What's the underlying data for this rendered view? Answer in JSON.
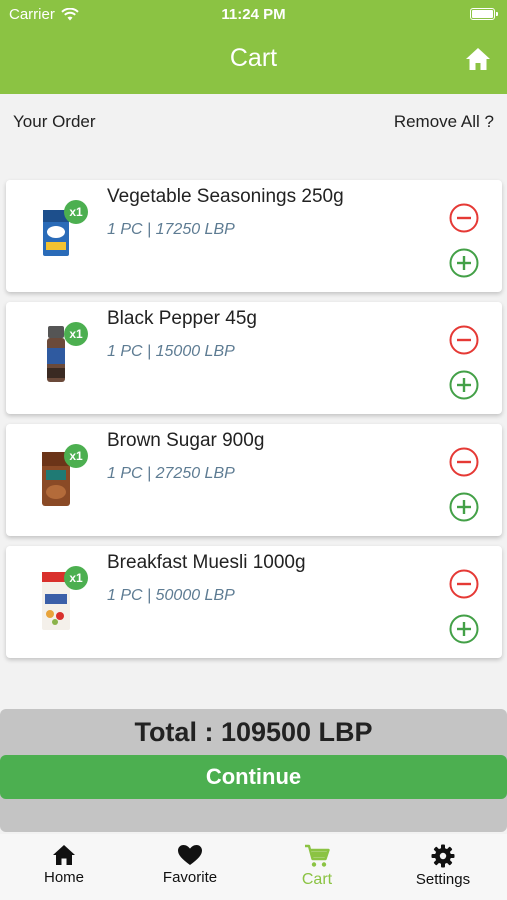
{
  "status_bar": {
    "carrier": "Carrier",
    "time": "11:24 PM"
  },
  "header": {
    "title": "Cart",
    "home_icon": "home-icon"
  },
  "order_bar": {
    "your_order": "Your Order",
    "remove_all": "Remove All ?"
  },
  "cart_items": [
    {
      "name": "Vegetable Seasonings 250g",
      "price": "1 PC | 17250 LBP",
      "qty_badge": "x1"
    },
    {
      "name": "Black Pepper 45g",
      "price": "1 PC | 15000 LBP",
      "qty_badge": "x1"
    },
    {
      "name": "Brown Sugar 900g",
      "price": "1 PC | 27250 LBP",
      "qty_badge": "x1"
    },
    {
      "name": "Breakfast Muesli 1000g",
      "price": "1 PC | 50000 LBP",
      "qty_badge": "x1"
    }
  ],
  "footer": {
    "total": "Total : 109500 LBP",
    "continue_label": "Continue"
  },
  "tabs": [
    {
      "label": "Home",
      "icon": "home-icon"
    },
    {
      "label": "Favorite",
      "icon": "heart-icon"
    },
    {
      "label": "Cart",
      "icon": "cart-icon",
      "active": true
    },
    {
      "label": "Settings",
      "icon": "gear-icon"
    }
  ],
  "colors": {
    "brand_green": "#8bc343",
    "button_green": "#4caf50",
    "remove_red": "#e53935",
    "price_blue": "#5e7c93"
  }
}
